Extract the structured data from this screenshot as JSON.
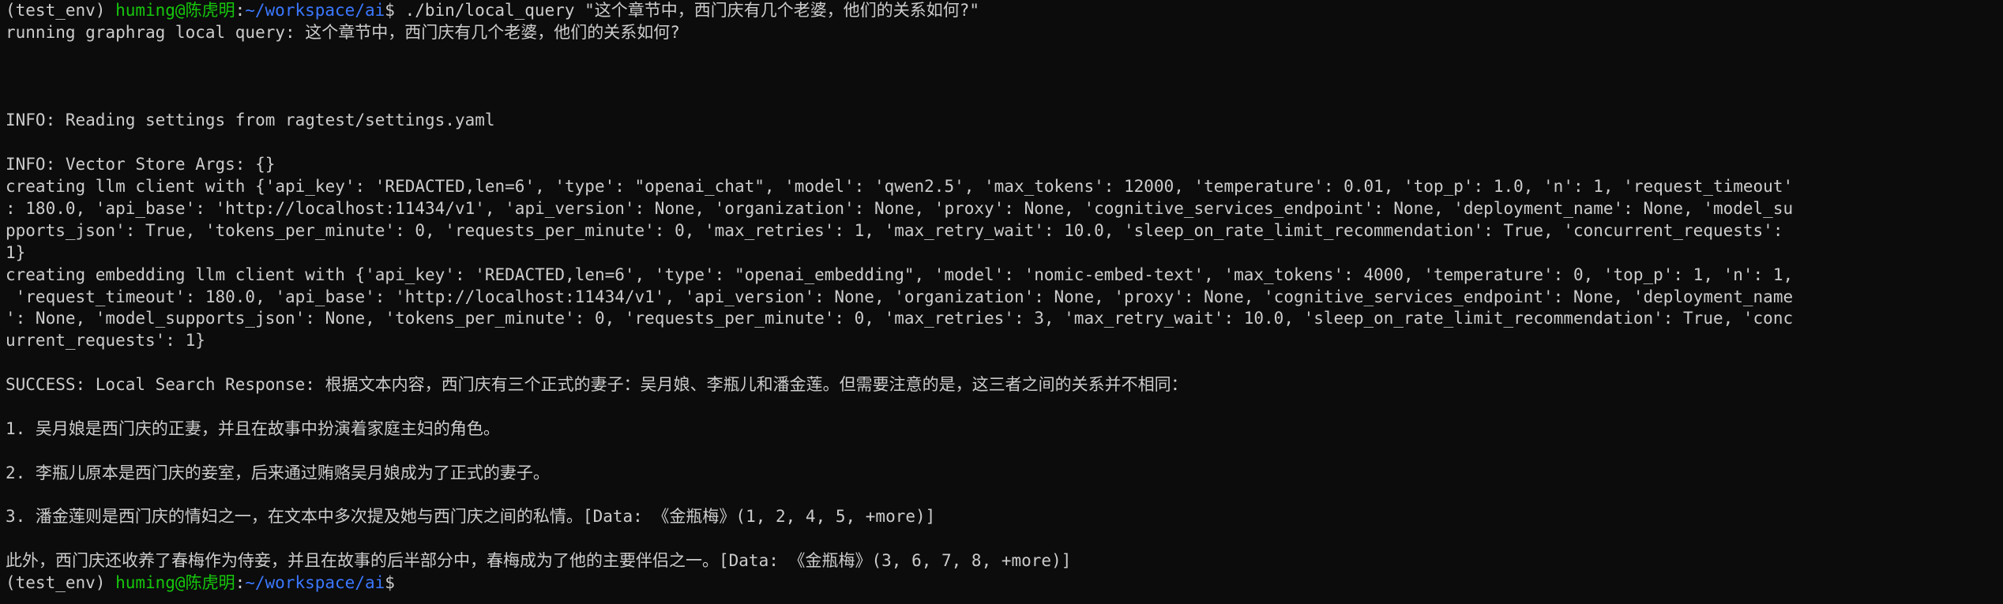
{
  "colors": {
    "background": "#0c0c0c",
    "text": "#cccccc",
    "user_host": "#16c60c",
    "cwd": "#3b78ff"
  },
  "prompt": {
    "env": "(test_env) ",
    "user_host": "huming@陈虎明",
    "separator": ":",
    "cwd": "~/workspace/ai",
    "symbol": "$ "
  },
  "command": "./bin/local_query \"这个章节中，西门庆有几个老婆，他们的关系如何?\"",
  "output_lines": [
    "running graphrag local query: 这个章节中，西门庆有几个老婆，他们的关系如何?",
    "",
    "",
    "",
    "INFO: Reading settings from ragtest/settings.yaml",
    "",
    "INFO: Vector Store Args: {}",
    "creating llm client with {'api_key': 'REDACTED,len=6', 'type': \"openai_chat\", 'model': 'qwen2.5', 'max_tokens': 12000, 'temperature': 0.01, 'top_p': 1.0, 'n': 1, 'request_timeout'",
    ": 180.0, 'api_base': 'http://localhost:11434/v1', 'api_version': None, 'organization': None, 'proxy': None, 'cognitive_services_endpoint': None, 'deployment_name': None, 'model_su",
    "pports_json': True, 'tokens_per_minute': 0, 'requests_per_minute': 0, 'max_retries': 1, 'max_retry_wait': 10.0, 'sleep_on_rate_limit_recommendation': True, 'concurrent_requests':",
    "1}",
    "creating embedding llm client with {'api_key': 'REDACTED,len=6', 'type': \"openai_embedding\", 'model': 'nomic-embed-text', 'max_tokens': 4000, 'temperature': 0, 'top_p': 1, 'n': 1,",
    " 'request_timeout': 180.0, 'api_base': 'http://localhost:11434/v1', 'api_version': None, 'organization': None, 'proxy': None, 'cognitive_services_endpoint': None, 'deployment_name",
    "': None, 'model_supports_json': None, 'tokens_per_minute': 0, 'requests_per_minute': 0, 'max_retries': 3, 'max_retry_wait': 10.0, 'sleep_on_rate_limit_recommendation': True, 'conc",
    "urrent_requests': 1}",
    "",
    "SUCCESS: Local Search Response: 根据文本内容，西门庆有三个正式的妻子：吴月娘、李瓶儿和潘金莲。但需要注意的是，这三者之间的关系并不相同：",
    "",
    "1. 吴月娘是西门庆的正妻，并且在故事中扮演着家庭主妇的角色。",
    "",
    "2. 李瓶儿原本是西门庆的妾室，后来通过贿赂吴月娘成为了正式的妻子。",
    "",
    "3. 潘金莲则是西门庆的情妇之一，在文本中多次提及她与西门庆之间的私情。[Data: 《金瓶梅》(1, 2, 4, 5, +more)]",
    "",
    "此外，西门庆还收养了春梅作为侍妾，并且在故事的后半部分中，春梅成为了他的主要伴侣之一。[Data: 《金瓶梅》(3, 6, 7, 8, +more)]"
  ]
}
